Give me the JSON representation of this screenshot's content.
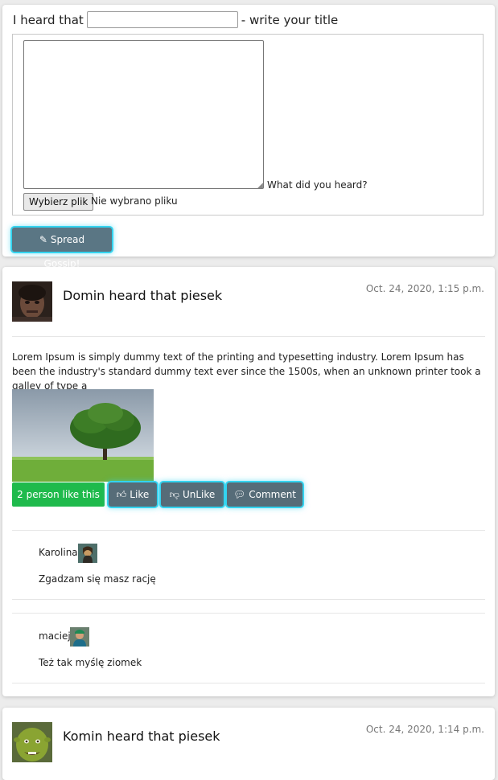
{
  "form": {
    "prefix": "I heard that",
    "title_placeholder": "",
    "title_value": "",
    "suffix": "- write your title",
    "textarea_label": "What did you heard?",
    "file_button": "Wybierz plik",
    "file_status": "Nie wybrano pliku",
    "submit_label": "Spread Gossip!",
    "submit_icon": "pencil-icon"
  },
  "posts": [
    {
      "title": "Domin heard that piesek",
      "date": "Oct. 24, 2020, 1:15 p.m.",
      "text": "Lorem Ipsum is simply dummy text of the printing and typesetting industry. Lorem Ipsum has been the industry's standard dummy text ever since the 1500s, when an unknown printer took a galley of type a",
      "likes_label": "2 person like this",
      "like_label": "Like",
      "unlike_label": "UnLike",
      "comment_label": "Comment",
      "comments": [
        {
          "author": "Karolina",
          "text": "Zgadzam się masz rację"
        },
        {
          "author": "maciej",
          "text": "Też tak myślę ziomek"
        }
      ]
    },
    {
      "title": "Komin heard that piesek",
      "date": "Oct. 24, 2020, 1:14 p.m."
    }
  ],
  "colors": {
    "submit_bg": "#5a7684",
    "likes_bg": "#1fba4c",
    "action_bg": "#566c78",
    "glow": "#33d4f0"
  }
}
